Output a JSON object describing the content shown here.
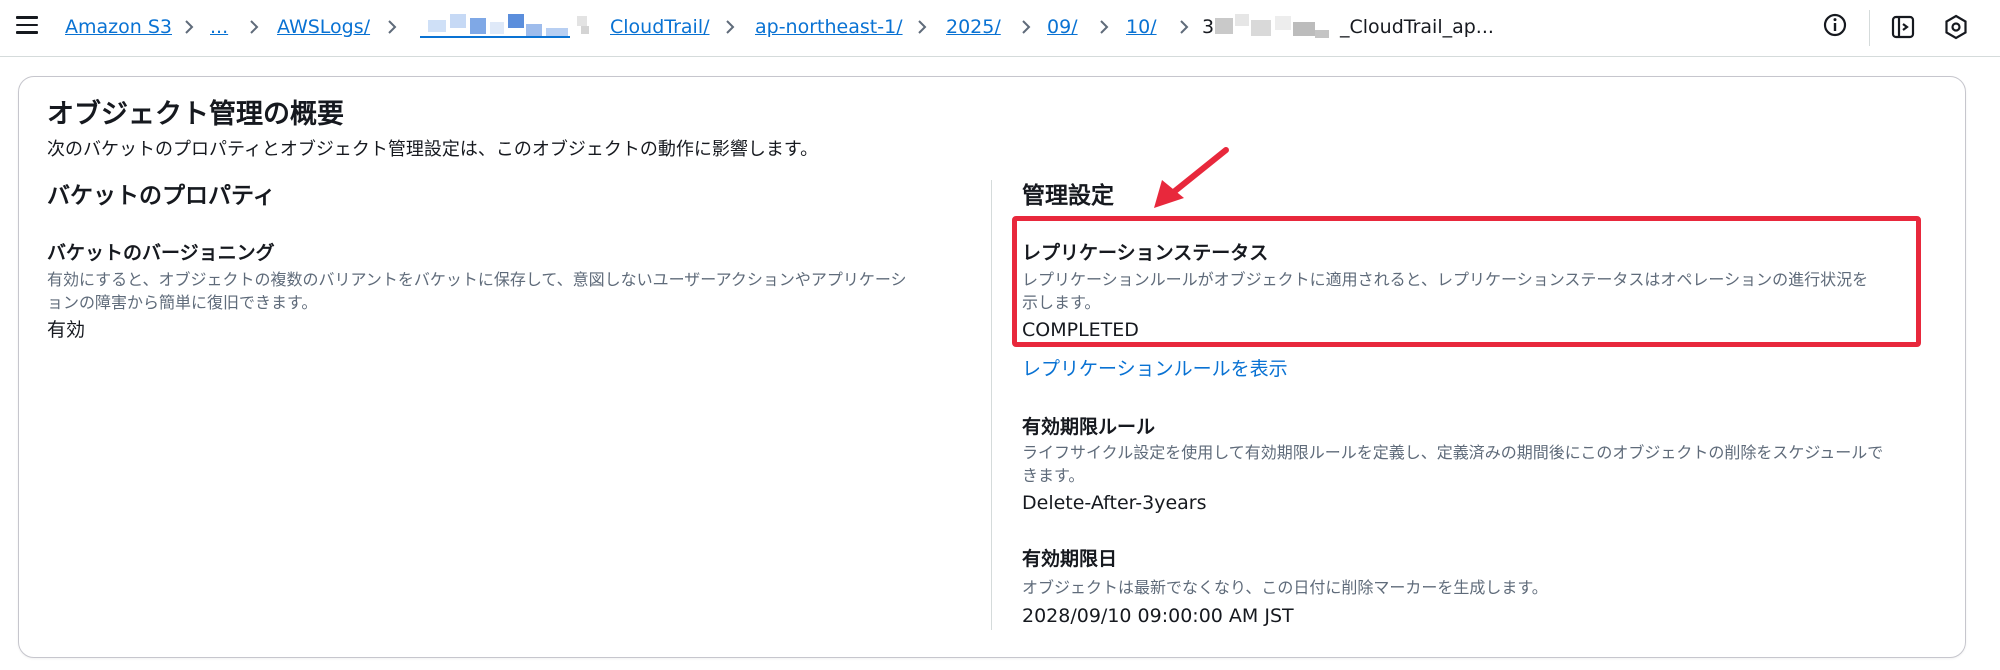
{
  "topbar": {
    "breadcrumbs": [
      {
        "label": "Amazon S3"
      },
      {
        "label": "..."
      },
      {
        "label": "AWSLogs/"
      },
      {
        "label": "CloudTrail/"
      },
      {
        "label": "ap-northeast-1/"
      },
      {
        "label": "2025/"
      },
      {
        "label": "09/"
      },
      {
        "label": "10/"
      }
    ],
    "current_prefix": "3",
    "current_suffix": "_CloudTrail_ap..."
  },
  "overview": {
    "title": "オブジェクト管理の概要",
    "description": "次のバケットのプロパティとオブジェクト管理設定は、このオブジェクトの動作に影響します。"
  },
  "bucket_properties": {
    "title": "バケットのプロパティ",
    "versioning": {
      "label": "バケットのバージョニング",
      "description_line1": "有効にすると、オブジェクトの複数のバリアントをバケットに保存して、意図しないユーザーアクションやアプリケーシ",
      "description_line2": "ョンの障害から簡単に復旧できます。",
      "value": "有効"
    }
  },
  "management": {
    "title": "管理設定",
    "replication": {
      "label": "レプリケーションステータス",
      "description_line1": "レプリケーションルールがオブジェクトに適用されると、レプリケーションステータスはオペレーションの進行状況を",
      "description_line2": "示します。",
      "value": "COMPLETED",
      "link": "レプリケーションルールを表示"
    },
    "expiration_rule": {
      "label": "有効期限ルール",
      "description_line1": "ライフサイクル設定を使用して有効期限ルールを定義し、定義済みの期間後にこのオブジェクトの削除をスケジュールで",
      "description_line2": "きます。",
      "value": "Delete-After-3years"
    },
    "expiration_date": {
      "label": "有効期限日",
      "description": "オブジェクトは最新でなくなり、この日付に削除マーカーを生成します。",
      "value": "2028/09/10 09:00:00 AM JST"
    }
  },
  "colors": {
    "link": "#0972d3",
    "highlight": "#e8283c",
    "text": "#16191f",
    "muted": "#5f6b7a"
  },
  "icons": [
    "menu-icon",
    "chevron-right-icon",
    "info-icon",
    "feedback-icon",
    "settings-icon",
    "annotation-arrow"
  ]
}
